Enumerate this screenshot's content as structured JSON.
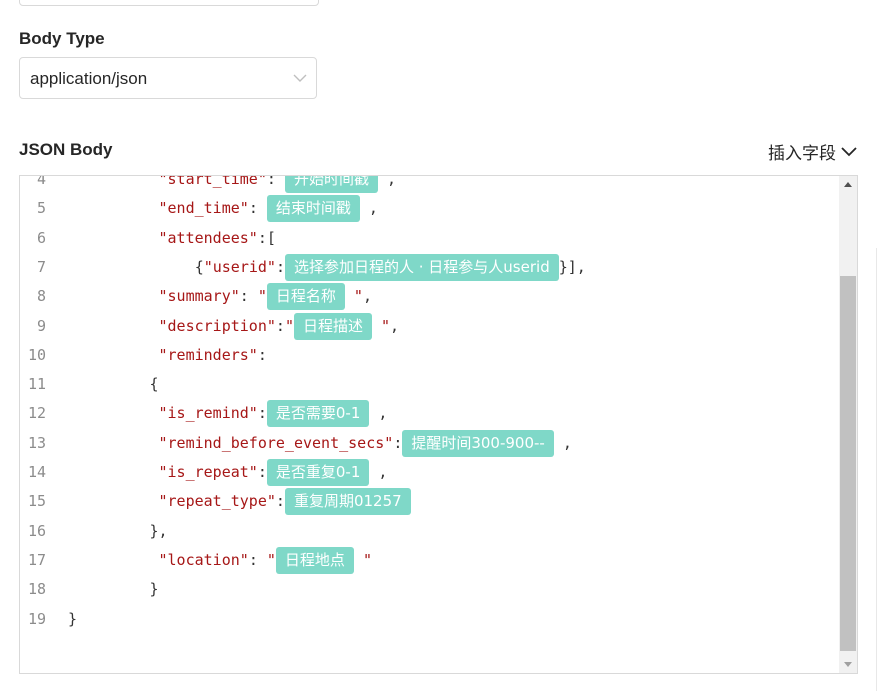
{
  "body_type": {
    "label": "Body Type",
    "value": "application/json"
  },
  "json_body": {
    "label": "JSON Body",
    "insert_field_label": "插入字段"
  },
  "editor_lines": [
    {
      "n": "4",
      "indent": 10,
      "parts": [
        {
          "t": "key",
          "v": "\"start_time\""
        },
        {
          "t": "p",
          "v": ": "
        },
        {
          "t": "tag",
          "v": "开始时间戳"
        },
        {
          "t": "p",
          "v": " ,"
        }
      ]
    },
    {
      "n": "5",
      "indent": 10,
      "parts": [
        {
          "t": "key",
          "v": "\"end_time\""
        },
        {
          "t": "p",
          "v": ": "
        },
        {
          "t": "tag",
          "v": "结束时间戳"
        },
        {
          "t": "p",
          "v": " ,"
        }
      ]
    },
    {
      "n": "6",
      "indent": 10,
      "parts": [
        {
          "t": "key",
          "v": "\"attendees\""
        },
        {
          "t": "p",
          "v": ":["
        }
      ]
    },
    {
      "n": "7",
      "indent": 14,
      "parts": [
        {
          "t": "p",
          "v": "{"
        },
        {
          "t": "key",
          "v": "\"userid\""
        },
        {
          "t": "p",
          "v": ":"
        },
        {
          "t": "tag",
          "v": "选择参加日程的人 · 日程参与人userid"
        },
        {
          "t": "p",
          "v": "}],"
        }
      ]
    },
    {
      "n": "8",
      "indent": 10,
      "parts": [
        {
          "t": "key",
          "v": "\"summary\""
        },
        {
          "t": "p",
          "v": ": "
        },
        {
          "t": "key",
          "v": "\""
        },
        {
          "t": "tag",
          "v": "日程名称"
        },
        {
          "t": "key",
          "v": " \""
        },
        {
          "t": "p",
          "v": ","
        }
      ]
    },
    {
      "n": "9",
      "indent": 10,
      "parts": [
        {
          "t": "key",
          "v": "\"description\""
        },
        {
          "t": "p",
          "v": ":"
        },
        {
          "t": "key",
          "v": "\""
        },
        {
          "t": "tag",
          "v": "日程描述"
        },
        {
          "t": "key",
          "v": " \""
        },
        {
          "t": "p",
          "v": ","
        }
      ]
    },
    {
      "n": "10",
      "indent": 10,
      "parts": [
        {
          "t": "key",
          "v": "\"reminders\""
        },
        {
          "t": "p",
          "v": ":"
        }
      ]
    },
    {
      "n": "11",
      "indent": 9,
      "parts": [
        {
          "t": "p",
          "v": "{"
        }
      ]
    },
    {
      "n": "12",
      "indent": 10,
      "parts": [
        {
          "t": "key",
          "v": "\"is_remind\""
        },
        {
          "t": "p",
          "v": ":"
        },
        {
          "t": "tag",
          "v": "是否需要0-1"
        },
        {
          "t": "p",
          "v": " ,"
        }
      ]
    },
    {
      "n": "13",
      "indent": 10,
      "parts": [
        {
          "t": "key",
          "v": "\"remind_before_event_secs\""
        },
        {
          "t": "p",
          "v": ":"
        },
        {
          "t": "tag",
          "v": "提醒时间300-900--"
        },
        {
          "t": "p",
          "v": " ,"
        }
      ]
    },
    {
      "n": "14",
      "indent": 10,
      "parts": [
        {
          "t": "key",
          "v": "\"is_repeat\""
        },
        {
          "t": "p",
          "v": ":"
        },
        {
          "t": "tag",
          "v": "是否重复0-1"
        },
        {
          "t": "p",
          "v": " ,"
        }
      ]
    },
    {
      "n": "15",
      "indent": 10,
      "parts": [
        {
          "t": "key",
          "v": "\"repeat_type\""
        },
        {
          "t": "p",
          "v": ":"
        },
        {
          "t": "tag",
          "v": "重复周期01257"
        }
      ]
    },
    {
      "n": "16",
      "indent": 9,
      "parts": [
        {
          "t": "p",
          "v": "},"
        }
      ]
    },
    {
      "n": "17",
      "indent": 10,
      "parts": [
        {
          "t": "key",
          "v": "\"location\""
        },
        {
          "t": "p",
          "v": ": "
        },
        {
          "t": "key",
          "v": "\""
        },
        {
          "t": "tag",
          "v": "日程地点"
        },
        {
          "t": "key",
          "v": " \""
        }
      ]
    },
    {
      "n": "18",
      "indent": 9,
      "parts": [
        {
          "t": "p",
          "v": "}"
        }
      ]
    },
    {
      "n": "19",
      "indent": 0,
      "parts": [
        {
          "t": "p",
          "v": "}"
        }
      ]
    }
  ]
}
